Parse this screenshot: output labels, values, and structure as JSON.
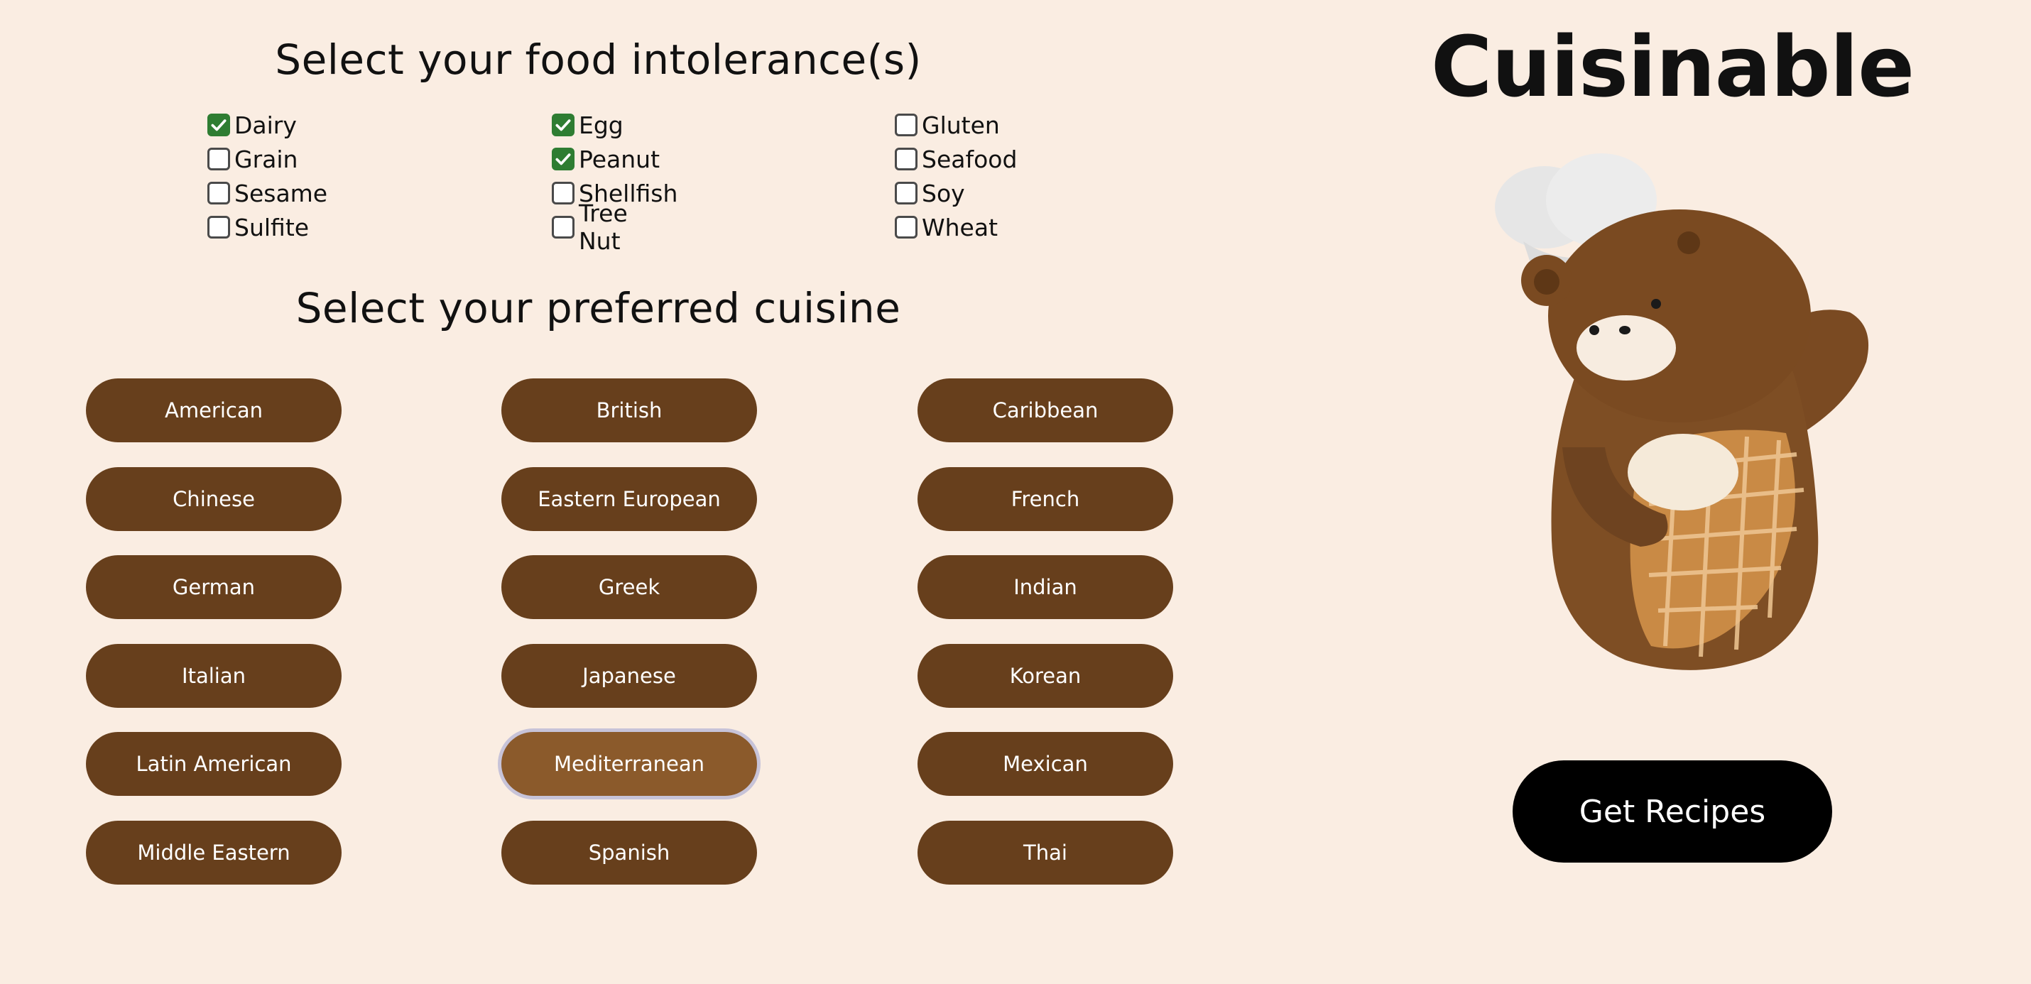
{
  "intolerance": {
    "heading": "Select your food intolerance(s)",
    "options": [
      {
        "label": "Dairy",
        "checked": true
      },
      {
        "label": "Egg",
        "checked": true
      },
      {
        "label": "Gluten",
        "checked": false
      },
      {
        "label": "Grain",
        "checked": false
      },
      {
        "label": "Peanut",
        "checked": true
      },
      {
        "label": "Seafood",
        "checked": false
      },
      {
        "label": "Sesame",
        "checked": false
      },
      {
        "label": "Shellfish",
        "checked": false
      },
      {
        "label": "Soy",
        "checked": false
      },
      {
        "label": "Sulfite",
        "checked": false
      },
      {
        "label": "Tree Nut",
        "checked": false
      },
      {
        "label": "Wheat",
        "checked": false
      }
    ]
  },
  "cuisine": {
    "heading": "Select your preferred cuisine",
    "options": [
      "American",
      "British",
      "Caribbean",
      "Chinese",
      "Eastern European",
      "French",
      "German",
      "Greek",
      "Indian",
      "Italian",
      "Japanese",
      "Korean",
      "Latin American",
      "Mediterranean",
      "Mexican",
      "Middle Eastern",
      "Spanish",
      "Thai"
    ],
    "selected": "Mediterranean"
  },
  "brand": {
    "title": "Cuisinable"
  },
  "mascot": {
    "icon": "chef-bear-icon"
  },
  "actions": {
    "get_recipes_label": "Get Recipes"
  },
  "colors": {
    "background": "#faede2",
    "button": "#673f1c",
    "button_selected": "#8b5a2b",
    "checkbox_checked": "#2e7d32",
    "primary_action": "#000000"
  }
}
